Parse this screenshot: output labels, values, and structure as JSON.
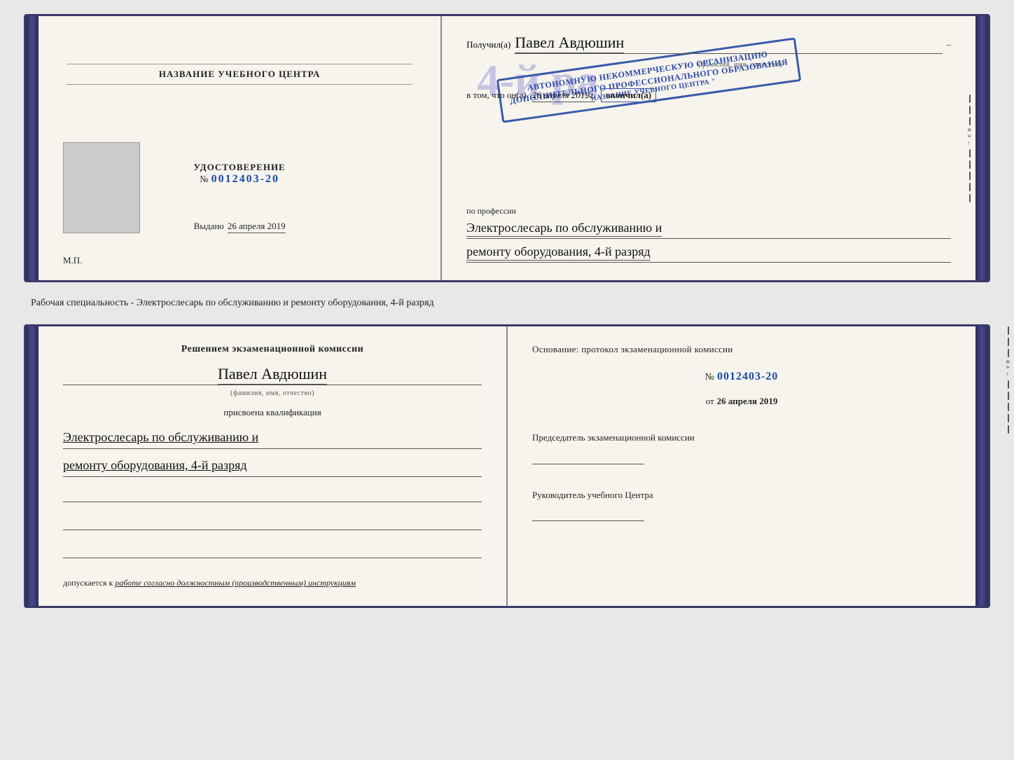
{
  "top_spread": {
    "left": {
      "center_title": "НАЗВАНИЕ УЧЕБНОГО ЦЕНТРА",
      "cert_label": "УДОСТОВЕРЕНИЕ",
      "cert_number_prefix": "№",
      "cert_number": "0012403-20",
      "issued_label": "Выдано",
      "issued_date": "26 апреля 2019",
      "mp_label": "М.П."
    },
    "right": {
      "recipient_label": "Получил(а)",
      "recipient_name": "Павел Авдюшин",
      "recipient_sub": "(фамилия, имя, отчество)",
      "vtom_prefix": "в том, что он(а)",
      "vtom_date": "26 апреля 2019г.",
      "okончил": "окончил(а)",
      "stamp_lines": [
        "4-й ра",
        "АВТОНОМНУЮ НЕКОММЕРЧЕСКУЮ ОРГАНИЗАЦИЮ",
        "ДОПОЛНИТЕЛЬНОГО ПРОФЕССИОНАЛЬНОГО ОБРАЗОВАНИЯ",
        "\" НАЗВАНИЕ УЧЕБНОГО ЦЕНТРА \""
      ],
      "po_professii": "по профессии",
      "profession_line1": "Электрослесарь по обслуживанию и",
      "profession_line2": "ремонту оборудования, 4-й разряд"
    }
  },
  "specialty_label": "Рабочая специальность - Электрослесарь по обслуживанию и ремонту оборудования, 4-й разряд",
  "bottom_spread": {
    "left": {
      "komissia_title": "Решением экзаменационной комиссии",
      "komissia_name": "Павел Авдюшин",
      "komissia_sub": "(фамилия, имя, отчество)",
      "prisvoena": "присвоена квалификация",
      "qualification_line1": "Электрослесарь по обслуживанию и",
      "qualification_line2": "ремонту оборудования, 4-й разряд",
      "dopuskaetsya_prefix": "допускается к",
      "dopuskaetsya_text": "работе согласно должностным (производственным) инструкциям"
    },
    "right": {
      "osnov_label": "Основание: протокол экзаменационной комиссии",
      "protocol_prefix": "№",
      "protocol_number": "0012403-20",
      "date_prefix": "от",
      "date_value": "26 апреля 2019",
      "chairman_label": "Председатель экзаменационной комиссии",
      "rukov_label": "Руководитель учебного Центра"
    }
  },
  "edge": {
    "letters": [
      "и",
      "а",
      "←"
    ],
    "dashes_count": 8
  }
}
